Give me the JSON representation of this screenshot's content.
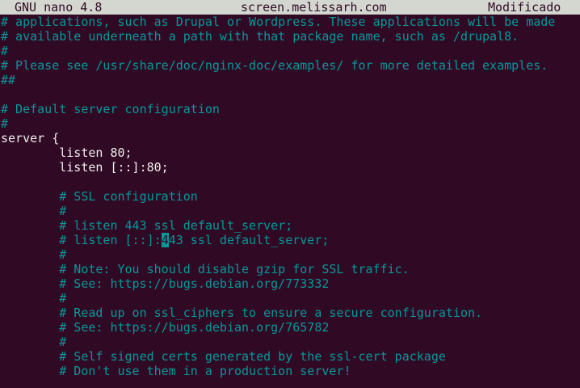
{
  "titlebar": {
    "app": "GNU nano 4.8",
    "filename": "screen.melissarh.com",
    "state": "Modificado"
  },
  "colors": {
    "background": "#300a24",
    "text": "#eeeeec",
    "comment": "#06989a",
    "titlebar_bg": "#d3d7cf"
  },
  "lines": [
    {
      "text": "# applications, such as Drupal or Wordpress. These applications will be made",
      "kind": "comment"
    },
    {
      "text": "# available underneath a path with that package name, such as /drupal8.",
      "kind": "comment"
    },
    {
      "text": "#",
      "kind": "comment"
    },
    {
      "text": "# Please see /usr/share/doc/nginx-doc/examples/ for more detailed examples.",
      "kind": "comment"
    },
    {
      "text": "##",
      "kind": "comment"
    },
    {
      "text": "",
      "kind": "code"
    },
    {
      "text": "# Default server configuration",
      "kind": "comment"
    },
    {
      "text": "#",
      "kind": "comment"
    },
    {
      "text": "server {",
      "kind": "code"
    },
    {
      "text": "        listen 80;",
      "kind": "code"
    },
    {
      "text": "        listen [::]:80;",
      "kind": "code"
    },
    {
      "text": "",
      "kind": "code"
    },
    {
      "text": "        # SSL configuration",
      "kind": "comment"
    },
    {
      "text": "        #",
      "kind": "comment"
    },
    {
      "text": "        # listen 443 ssl default_server;",
      "kind": "comment"
    },
    {
      "text": "        # listen [::]:443 ssl default_server;",
      "kind": "comment",
      "cursor_col": 22
    },
    {
      "text": "        #",
      "kind": "comment"
    },
    {
      "text": "        # Note: You should disable gzip for SSL traffic.",
      "kind": "comment"
    },
    {
      "text": "        # See: https://bugs.debian.org/773332",
      "kind": "comment"
    },
    {
      "text": "        #",
      "kind": "comment"
    },
    {
      "text": "        # Read up on ssl_ciphers to ensure a secure configuration.",
      "kind": "comment"
    },
    {
      "text": "        # See: https://bugs.debian.org/765782",
      "kind": "comment"
    },
    {
      "text": "        #",
      "kind": "comment"
    },
    {
      "text": "        # Self signed certs generated by the ssl-cert package",
      "kind": "comment"
    },
    {
      "text": "        # Don't use them in a production server!",
      "kind": "comment"
    }
  ]
}
